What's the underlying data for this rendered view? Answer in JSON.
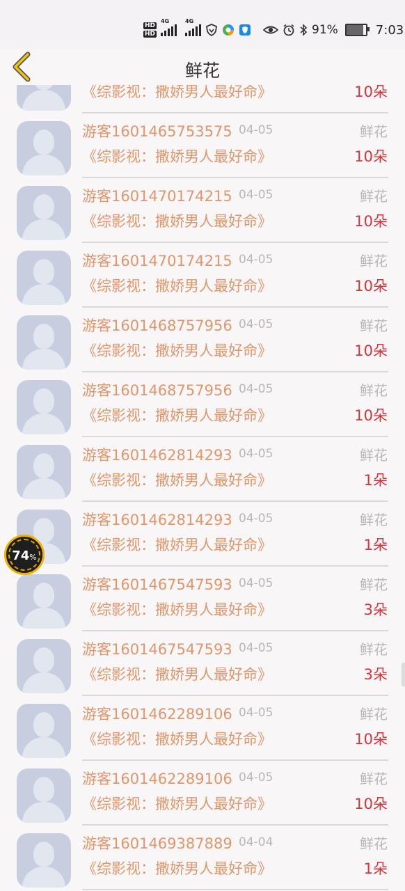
{
  "status": {
    "hd1": "HD",
    "hd2": "HD",
    "net1": "4G",
    "net2": "4G",
    "battery": "91%",
    "time": "7:03"
  },
  "header": {
    "title": "鲜花"
  },
  "overlay": {
    "percent": "74",
    "percent_sign": "%"
  },
  "list": [
    {
      "user": "",
      "date": "",
      "gift": "",
      "book": "《综影视：撒娇男人最好命》",
      "qty": "10朵"
    },
    {
      "user": "游客1601465753575",
      "date": "04-05",
      "gift": "鲜花",
      "book": "《综影视：撒娇男人最好命》",
      "qty": "10朵"
    },
    {
      "user": "游客1601470174215",
      "date": "04-05",
      "gift": "鲜花",
      "book": "《综影视：撒娇男人最好命》",
      "qty": "10朵"
    },
    {
      "user": "游客1601470174215",
      "date": "04-05",
      "gift": "鲜花",
      "book": "《综影视：撒娇男人最好命》",
      "qty": "10朵"
    },
    {
      "user": "游客1601468757956",
      "date": "04-05",
      "gift": "鲜花",
      "book": "《综影视：撒娇男人最好命》",
      "qty": "10朵"
    },
    {
      "user": "游客1601468757956",
      "date": "04-05",
      "gift": "鲜花",
      "book": "《综影视：撒娇男人最好命》",
      "qty": "10朵"
    },
    {
      "user": "游客1601462814293",
      "date": "04-05",
      "gift": "鲜花",
      "book": "《综影视：撒娇男人最好命》",
      "qty": "1朵"
    },
    {
      "user": "游客1601462814293",
      "date": "04-05",
      "gift": "鲜花",
      "book": "《综影视：撒娇男人最好命》",
      "qty": "1朵"
    },
    {
      "user": "游客1601467547593",
      "date": "04-05",
      "gift": "鲜花",
      "book": "《综影视：撒娇男人最好命》",
      "qty": "3朵"
    },
    {
      "user": "游客1601467547593",
      "date": "04-05",
      "gift": "鲜花",
      "book": "《综影视：撒娇男人最好命》",
      "qty": "3朵"
    },
    {
      "user": "游客1601462289106",
      "date": "04-05",
      "gift": "鲜花",
      "book": "《综影视：撒娇男人最好命》",
      "qty": "10朵"
    },
    {
      "user": "游客1601462289106",
      "date": "04-05",
      "gift": "鲜花",
      "book": "《综影视：撒娇男人最好命》",
      "qty": "10朵"
    },
    {
      "user": "游客1601469387889",
      "date": "04-04",
      "gift": "鲜花",
      "book": "《综影视：撒娇男人最好命》",
      "qty": "1朵"
    }
  ]
}
